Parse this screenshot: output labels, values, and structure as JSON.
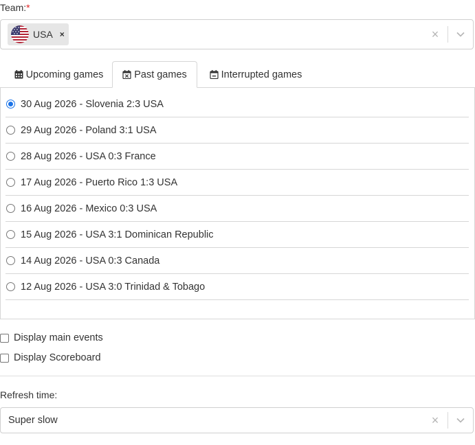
{
  "team": {
    "label": "Team:",
    "required_mark": "*",
    "selected": [
      {
        "label": "USA",
        "flag_icon": "usa-flag-icon"
      }
    ],
    "remove_glyph": "×",
    "clear_glyph": "×"
  },
  "tabs": [
    {
      "label": "Upcoming games",
      "icon": "calendar-icon",
      "active": false
    },
    {
      "label": "Past games",
      "icon": "calendar-x-icon",
      "active": true
    },
    {
      "label": "Interrupted games",
      "icon": "calendar-minus-icon",
      "active": false
    }
  ],
  "games": [
    {
      "label": "30 Aug 2026 - Slovenia 2:3 USA",
      "checked": true
    },
    {
      "label": "29 Aug 2026 - Poland 3:1 USA",
      "checked": false
    },
    {
      "label": "28 Aug 2026 - USA 0:3 France",
      "checked": false
    },
    {
      "label": "17 Aug 2026 - Puerto Rico 1:3 USA",
      "checked": false
    },
    {
      "label": "16 Aug 2026 - Mexico 0:3 USA",
      "checked": false
    },
    {
      "label": "15 Aug 2026 - USA 3:1 Dominican Republic",
      "checked": false
    },
    {
      "label": "14 Aug 2026 - USA 0:3 Canada",
      "checked": false
    },
    {
      "label": "12 Aug 2026 - USA 3:0 Trinidad & Tobago",
      "checked": false
    }
  ],
  "options": {
    "display_main_events": {
      "label": "Display main events",
      "checked": false
    },
    "display_scoreboard": {
      "label": "Display Scoreboard",
      "checked": false
    }
  },
  "refresh": {
    "label": "Refresh time:",
    "value": "Super slow",
    "clear_glyph": "×"
  },
  "colors": {
    "accent": "#1a73e8",
    "required": "#e02424",
    "border": "#cfcfcf"
  }
}
